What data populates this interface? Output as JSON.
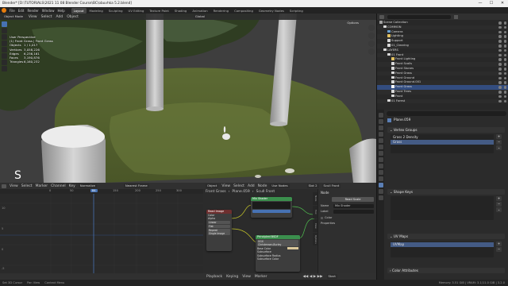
{
  "window": {
    "title": "Blender* [D:\\TUTORIALS\\2021 11 08 Blender Course\\BC\\obuvhka 5.2.blend]",
    "min": "—",
    "max": "☐",
    "close": "✕"
  },
  "menu": {
    "items": [
      "File",
      "Edit",
      "Render",
      "Window",
      "Help"
    ]
  },
  "workspaces": [
    "Layout",
    "Modeling",
    "Sculpting",
    "UV Editing",
    "Texture Paint",
    "Shading",
    "Animation",
    "Rendering",
    "Compositing",
    "Geometry Nodes",
    "Scripting"
  ],
  "workspace_active": "Layout",
  "viewport": {
    "mode": "Object Mode",
    "menus": [
      "View",
      "Select",
      "Add",
      "Object"
    ],
    "transform": "Global",
    "options": "Options",
    "stats_header": "User Perspective",
    "stats_sub": "(1) Front Grass | Front Grass",
    "stats": [
      {
        "k": "Objects",
        "v": "1 / 1,017"
      },
      {
        "k": "Vertices",
        "v": "3,058,226"
      },
      {
        "k": "Edges",
        "v": "6,236,161"
      },
      {
        "k": "Faces",
        "v": "3,190,876"
      },
      {
        "k": "Triangles",
        "v": "6,160,232"
      }
    ],
    "key_overlay": "S"
  },
  "graph_editor": {
    "mode": "Graph Editor",
    "menus": [
      "View",
      "Select",
      "Marker",
      "Channel",
      "Key"
    ],
    "normalize": "Normalize",
    "pivot": "Nearest Frame",
    "ruler": [
      "0",
      "50",
      "100",
      "150",
      "200",
      "250",
      "300",
      "350"
    ],
    "current_frame": "84",
    "y_labels": [
      "10",
      "5",
      "0",
      "-5"
    ]
  },
  "node_editor": {
    "object": "Object",
    "menus": [
      "View",
      "Select",
      "Add",
      "Node"
    ],
    "use_nodes": "Use Nodes",
    "slot": "Slot 2",
    "material": "Scull Front",
    "breadcrumb": [
      "Front Grass",
      "Plane.059",
      "Scull Front"
    ],
    "sidebar": {
      "section": "Node",
      "name_label": "Name",
      "name_value": "Mix Shader",
      "label_label": "Label",
      "node_title": "Read Scale",
      "color": "Color",
      "properties": "Properties"
    },
    "sidebar_tabs": [
      "Node",
      "Tool",
      "View",
      "Options",
      "Node Wrangler"
    ],
    "nodes": {
      "mix": "Mix Shader",
      "bsdf": "Principled BSDF",
      "bsdf_fields": [
        "GGX",
        "Christensen-Burley",
        "Base Color",
        "Subsurface",
        "Subsurface Radius",
        "Subsurface Color"
      ],
      "tex": "Read Image",
      "tex_fields": [
        "Color",
        "Alpha",
        "Linear",
        "Flat",
        "Repeat",
        "Single Image"
      ]
    },
    "footer": [
      "Playback",
      "Keying",
      "View",
      "Marker"
    ],
    "start": "Start"
  },
  "outliner": {
    "search": "",
    "rows": [
      {
        "label": "Scene Collection",
        "indent": 0,
        "color": "#a0a0a0"
      },
      {
        "label": "COMMON",
        "indent": 1,
        "color": "#d8d8d8"
      },
      {
        "label": "Camera",
        "indent": 2,
        "color": "#6aa0d0"
      },
      {
        "label": "Lighting",
        "indent": 2,
        "color": "#e0c060"
      },
      {
        "label": "Support",
        "indent": 2,
        "color": "#d8d8d8"
      },
      {
        "label": "01_Clearing",
        "indent": 2,
        "color": "#d8d8d8"
      },
      {
        "label": "LAYERS",
        "indent": 1,
        "color": "#d8d8d8"
      },
      {
        "label": "01 Front",
        "indent": 2,
        "color": "#d8d8d8"
      },
      {
        "label": "Front Lighting",
        "indent": 3,
        "color": "#e0c060"
      },
      {
        "label": "Front Scalls",
        "indent": 3,
        "color": "#d8d8d8"
      },
      {
        "label": "Front Stones",
        "indent": 3,
        "color": "#d8d8d8"
      },
      {
        "label": "Front Grass",
        "indent": 3,
        "color": "#d8d8d8"
      },
      {
        "label": "Front Ground",
        "indent": 3,
        "color": "#d8d8d8"
      },
      {
        "label": "Front Ground.001",
        "indent": 3,
        "color": "#d8d8d8"
      },
      {
        "label": "Front Grass",
        "indent": 3,
        "color": "#ffffff",
        "selected": true
      },
      {
        "label": "Front Trees",
        "indent": 3,
        "color": "#d8d8d8"
      },
      {
        "label": "Front",
        "indent": 3,
        "color": "#d8d8d8"
      },
      {
        "label": "01 Forest",
        "indent": 2,
        "color": "#d8d8d8"
      }
    ]
  },
  "properties": {
    "object_name": "Plane.059",
    "vertex_groups": {
      "title": "Vertex Groups",
      "items": [
        "Grass 2 Density",
        "Grass"
      ],
      "selected": 1
    },
    "shape_keys": "Shape Keys",
    "uv_maps": {
      "title": "UV Maps",
      "items": [
        "UVMap"
      ]
    },
    "color_attributes": "Color Attributes"
  },
  "statusbar": {
    "left": [
      "Set 3D Cursor",
      "Pan View",
      "Context Menu"
    ],
    "right": "Memory: 3.51 GiB | VRAM: 3.1/11.0 GiB | 3.2.0"
  },
  "colors": {
    "accent": "#4772b3",
    "selection": "#334d80",
    "node_shader": "#3b8f4d",
    "node_texture": "#b03030",
    "node_input": "#6e2f2f"
  }
}
